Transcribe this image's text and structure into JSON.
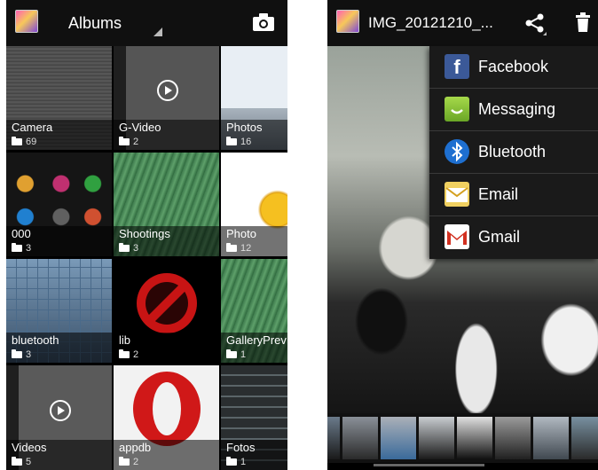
{
  "gallery": {
    "title": "Albums",
    "albums": [
      {
        "name": "Camera",
        "count": "69"
      },
      {
        "name": "G-Video",
        "count": "2"
      },
      {
        "name": "Photos",
        "count": "16"
      },
      {
        "name": "000",
        "count": "3"
      },
      {
        "name": "Shootings",
        "count": "3"
      },
      {
        "name": "Photo",
        "count": "12"
      },
      {
        "name": "bluetooth",
        "count": "3"
      },
      {
        "name": "lib",
        "count": "2"
      },
      {
        "name": "GalleryPrev",
        "count": "1"
      },
      {
        "name": "Videos",
        "count": "5"
      },
      {
        "name": "appdb",
        "count": "2"
      },
      {
        "name": "Fotos",
        "count": "1"
      }
    ]
  },
  "viewer": {
    "title": "IMG_20121210_...",
    "share_menu": [
      {
        "label": "Facebook"
      },
      {
        "label": "Messaging"
      },
      {
        "label": "Bluetooth"
      },
      {
        "label": "Email"
      },
      {
        "label": "Gmail"
      }
    ]
  }
}
